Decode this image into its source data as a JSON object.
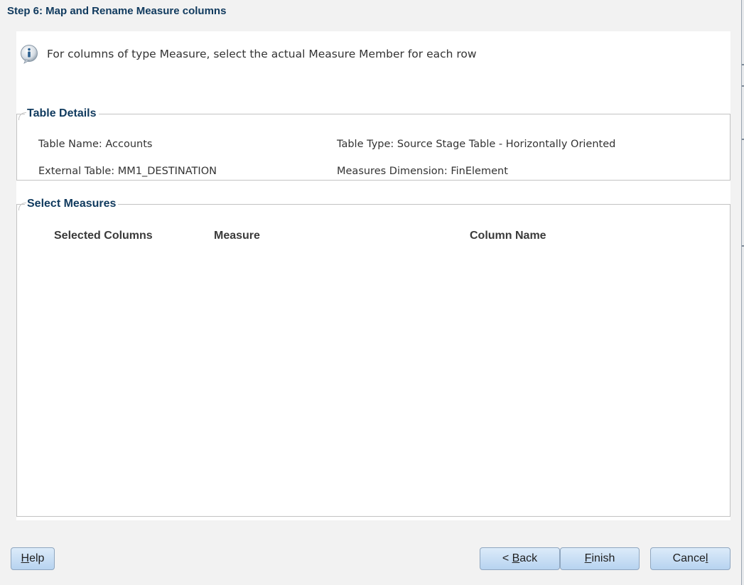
{
  "wizard": {
    "step_title": "Step 6: Map and Rename Measure columns"
  },
  "info": {
    "icon": "info-icon",
    "text": "For columns of type Measure, select the actual Measure Member for each row"
  },
  "table_details": {
    "legend": "Table Details",
    "table_name": "Table Name: Accounts",
    "table_type": "Table Type: Source Stage Table - Horizontally Oriented",
    "external_table": "External Table: MM1_DESTINATION",
    "measures_dimension": "Measures Dimension: FinElement"
  },
  "select_measures": {
    "legend": "Select Measures",
    "columns": [
      "Selected Columns",
      "Measure",
      "Column Name"
    ]
  },
  "buttons": {
    "help": {
      "pre": "",
      "key": "H",
      "post": "elp"
    },
    "back": {
      "pre": "< ",
      "key": "B",
      "post": "ack"
    },
    "finish": {
      "pre": "",
      "key": "F",
      "post": "inish"
    },
    "cancel": {
      "pre": "Cance",
      "key": "l",
      "post": ""
    }
  },
  "colors": {
    "title": "#103a5e",
    "button_top": "#dcebf9",
    "button_bottom": "#b7d3f0"
  }
}
